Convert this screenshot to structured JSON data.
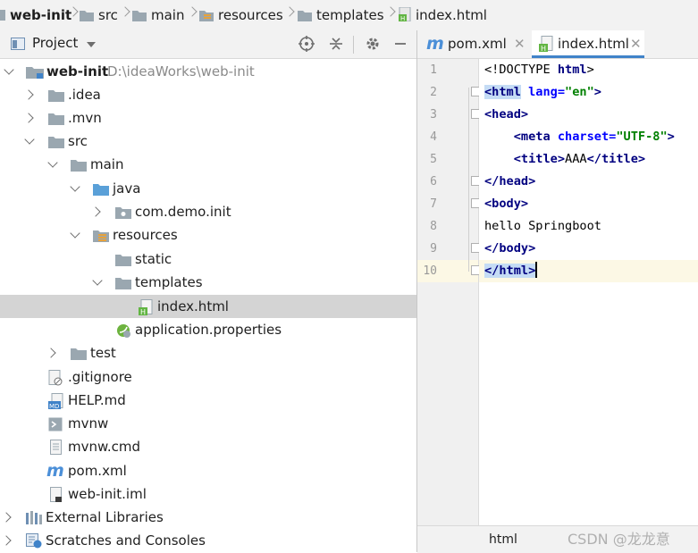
{
  "breadcrumb": [
    {
      "label": "web-init",
      "icon": "module-folder-icon"
    },
    {
      "label": "src",
      "icon": "folder-icon"
    },
    {
      "label": "main",
      "icon": "folder-icon"
    },
    {
      "label": "resources",
      "icon": "resources-folder-icon"
    },
    {
      "label": "templates",
      "icon": "folder-icon"
    },
    {
      "label": "index.html",
      "icon": "html-file-icon"
    }
  ],
  "project_panel": {
    "title": "Project",
    "tools": [
      "target-icon",
      "collapse-icon",
      "gear-icon",
      "minimize-icon"
    ]
  },
  "tree": [
    {
      "label": "web-init",
      "extra": "D:\\ideaWorks\\web-init",
      "icon": "module-folder-icon",
      "expanded": true
    },
    {
      "label": ".idea",
      "icon": "folder-icon",
      "expanded": false
    },
    {
      "label": ".mvn",
      "icon": "folder-icon",
      "expanded": false
    },
    {
      "label": "src",
      "icon": "folder-icon",
      "expanded": true
    },
    {
      "label": "main",
      "icon": "folder-icon",
      "expanded": true
    },
    {
      "label": "java",
      "icon": "source-folder-icon",
      "expanded": true
    },
    {
      "label": "com.demo.init",
      "icon": "package-icon",
      "expanded": false
    },
    {
      "label": "resources",
      "icon": "resources-folder-icon",
      "expanded": true
    },
    {
      "label": "static",
      "icon": "folder-icon"
    },
    {
      "label": "templates",
      "icon": "folder-icon",
      "expanded": true
    },
    {
      "label": "index.html",
      "icon": "html-file-icon",
      "selected": true
    },
    {
      "label": "application.properties",
      "icon": "spring-properties-icon"
    },
    {
      "label": "test",
      "icon": "folder-icon",
      "expanded": false
    },
    {
      "label": ".gitignore",
      "icon": "gitignore-file-icon"
    },
    {
      "label": "HELP.md",
      "icon": "markdown-file-icon"
    },
    {
      "label": "mvnw",
      "icon": "shell-file-icon"
    },
    {
      "label": "mvnw.cmd",
      "icon": "text-file-icon"
    },
    {
      "label": "pom.xml",
      "icon": "maven-file-icon"
    },
    {
      "label": "web-init.iml",
      "icon": "iml-file-icon"
    },
    {
      "label": "External Libraries",
      "icon": "libraries-icon",
      "expanded": false
    },
    {
      "label": "Scratches and Consoles",
      "icon": "scratches-icon",
      "expanded": false
    }
  ],
  "editor": {
    "tabs": [
      {
        "label": "pom.xml",
        "icon": "maven-file-icon",
        "active": false
      },
      {
        "label": "index.html",
        "icon": "html-file-icon",
        "active": true
      }
    ],
    "line_numbers": [
      "1",
      "2",
      "3",
      "4",
      "5",
      "6",
      "7",
      "8",
      "9",
      "10"
    ],
    "code": {
      "l1a": "<!DOCTYPE ",
      "l1b": "html",
      "l1c": ">",
      "l2a": "<html",
      " l2b": " lang=",
      "l2c": "\"en\"",
      "l2d": ">",
      "l3": "<head>",
      "l4a": "    <meta",
      " l4b": " charset=",
      "l4c": "\"UTF-8\"",
      "l4d": ">",
      "l5a": "    <title>",
      "l5b": "AAA",
      "l5c": "</title>",
      "l6": "</head>",
      "l7": "<body>",
      "l8": "hello Springboot",
      "l9": "</body>",
      "l10": "</html>"
    },
    "current_line": "10",
    "status_text": "html"
  },
  "watermark": "CSDN @龙龙意",
  "colors": {
    "tag": "#000080",
    "attr": "#0000ff",
    "string": "#008000",
    "selection": "#d4d4d4",
    "tab_accent": "#4083c9"
  }
}
